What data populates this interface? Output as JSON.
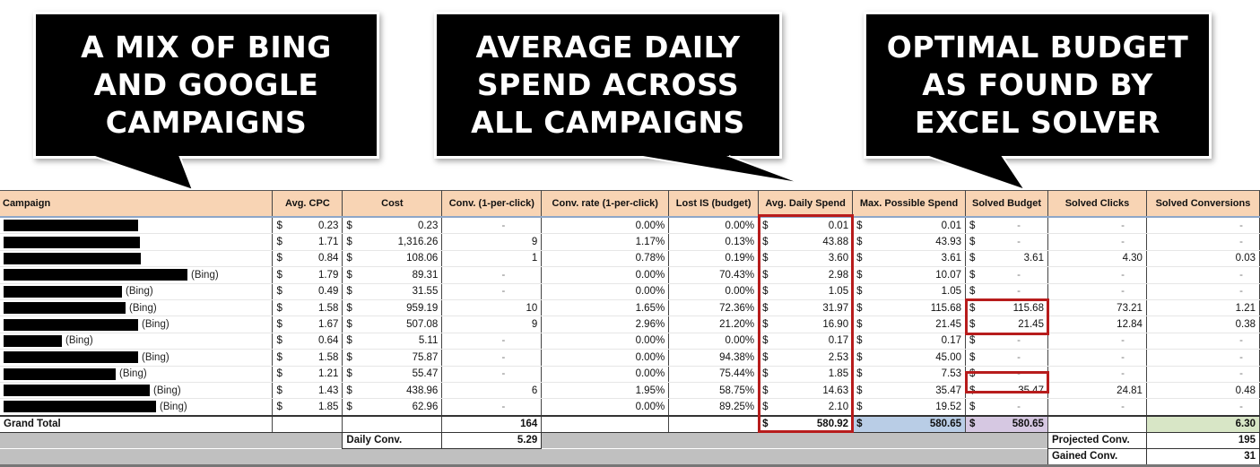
{
  "callouts": [
    {
      "lines": [
        "A MIX OF BING",
        "AND GOOGLE",
        "CAMPAIGNS"
      ]
    },
    {
      "lines": [
        "AVERAGE DAILY",
        "SPEND ACROSS",
        "ALL CAMPAIGNS"
      ]
    },
    {
      "lines": [
        "OPTIMAL BUDGET",
        "AS FOUND BY",
        "EXCEL SOLVER"
      ]
    }
  ],
  "colors": {
    "header_bg": "#f8d4b4",
    "highlight_red": "#b71c1c",
    "max_total_bg": "#b9cde6",
    "solved_total_bg": "#d6c8e2",
    "solved_conv_total_bg": "#d8e6c6",
    "footer_bg": "#c0c0c0"
  },
  "table": {
    "headers": {
      "campaign": "Campaign",
      "avg_cpc": "Avg. CPC",
      "cost": "Cost",
      "conv": "Conv. (1-per-click)",
      "conv_rate": "Conv. rate (1-per-click)",
      "lost_is": "Lost IS (budget)",
      "avg_daily_spend": "Avg. Daily Spend",
      "max_possible_spend": "Max. Possible Spend",
      "solved_budget": "Solved Budget",
      "solved_clicks": "Solved Clicks",
      "solved_conversions": "Solved Conversions"
    },
    "currency_symbol": "$",
    "rows": [
      {
        "tag": "",
        "redacted": true,
        "avg_cpc": "0.23",
        "cost": "0.23",
        "conv": "-",
        "conv_rate": "0.00%",
        "lost_is": "0.00%",
        "avg_daily_spend": "0.01",
        "max_possible_spend": "0.01",
        "solved_budget": "-",
        "solved_clicks": "-",
        "solved_conversions": "-"
      },
      {
        "tag": "",
        "redacted": true,
        "avg_cpc": "1.71",
        "cost": "1,316.26",
        "conv": "9",
        "conv_rate": "1.17%",
        "lost_is": "0.13%",
        "avg_daily_spend": "43.88",
        "max_possible_spend": "43.93",
        "solved_budget": "-",
        "solved_clicks": "-",
        "solved_conversions": "-"
      },
      {
        "tag": "",
        "redacted": true,
        "avg_cpc": "0.84",
        "cost": "108.06",
        "conv": "1",
        "conv_rate": "0.78%",
        "lost_is": "0.19%",
        "avg_daily_spend": "3.60",
        "max_possible_spend": "3.61",
        "solved_budget": "3.61",
        "solved_clicks": "4.30",
        "solved_conversions": "0.03"
      },
      {
        "tag": "(Bing)",
        "redacted": true,
        "avg_cpc": "1.79",
        "cost": "89.31",
        "conv": "-",
        "conv_rate": "0.00%",
        "lost_is": "70.43%",
        "avg_daily_spend": "2.98",
        "max_possible_spend": "10.07",
        "solved_budget": "-",
        "solved_clicks": "-",
        "solved_conversions": "-"
      },
      {
        "tag": "(Bing)",
        "redacted": true,
        "avg_cpc": "0.49",
        "cost": "31.55",
        "conv": "-",
        "conv_rate": "0.00%",
        "lost_is": "0.00%",
        "avg_daily_spend": "1.05",
        "max_possible_spend": "1.05",
        "solved_budget": "-",
        "solved_clicks": "-",
        "solved_conversions": "-"
      },
      {
        "tag": "(Bing)",
        "redacted": true,
        "avg_cpc": "1.58",
        "cost": "959.19",
        "conv": "10",
        "conv_rate": "1.65%",
        "lost_is": "72.36%",
        "avg_daily_spend": "31.97",
        "max_possible_spend": "115.68",
        "solved_budget": "115.68",
        "solved_clicks": "73.21",
        "solved_conversions": "1.21"
      },
      {
        "tag": "(Bing)",
        "redacted": true,
        "avg_cpc": "1.67",
        "cost": "507.08",
        "conv": "9",
        "conv_rate": "2.96%",
        "lost_is": "21.20%",
        "avg_daily_spend": "16.90",
        "max_possible_spend": "21.45",
        "solved_budget": "21.45",
        "solved_clicks": "12.84",
        "solved_conversions": "0.38"
      },
      {
        "tag": "(Bing)",
        "redacted": true,
        "avg_cpc": "0.64",
        "cost": "5.11",
        "conv": "-",
        "conv_rate": "0.00%",
        "lost_is": "0.00%",
        "avg_daily_spend": "0.17",
        "max_possible_spend": "0.17",
        "solved_budget": "-",
        "solved_clicks": "-",
        "solved_conversions": "-"
      },
      {
        "tag": "(Bing)",
        "redacted": true,
        "avg_cpc": "1.58",
        "cost": "75.87",
        "conv": "-",
        "conv_rate": "0.00%",
        "lost_is": "94.38%",
        "avg_daily_spend": "2.53",
        "max_possible_spend": "45.00",
        "solved_budget": "-",
        "solved_clicks": "-",
        "solved_conversions": "-"
      },
      {
        "tag": "(Bing)",
        "redacted": true,
        "avg_cpc": "1.21",
        "cost": "55.47",
        "conv": "-",
        "conv_rate": "0.00%",
        "lost_is": "75.44%",
        "avg_daily_spend": "1.85",
        "max_possible_spend": "7.53",
        "solved_budget": "-",
        "solved_clicks": "-",
        "solved_conversions": "-"
      },
      {
        "tag": "(Bing)",
        "redacted": true,
        "avg_cpc": "1.43",
        "cost": "438.96",
        "conv": "6",
        "conv_rate": "1.95%",
        "lost_is": "58.75%",
        "avg_daily_spend": "14.63",
        "max_possible_spend": "35.47",
        "solved_budget": "35.47",
        "solved_clicks": "24.81",
        "solved_conversions": "0.48"
      },
      {
        "tag": "(Bing)",
        "redacted": true,
        "avg_cpc": "1.85",
        "cost": "62.96",
        "conv": "-",
        "conv_rate": "0.00%",
        "lost_is": "89.25%",
        "avg_daily_spend": "2.10",
        "max_possible_spend": "19.52",
        "solved_budget": "-",
        "solved_clicks": "-",
        "solved_conversions": "-"
      }
    ],
    "grand_total": {
      "label": "Grand Total",
      "conv": "164",
      "avg_daily_spend": "580.92",
      "max_possible_spend": "580.65",
      "solved_budget": "580.65",
      "solved_conversions": "6.30"
    },
    "summary": {
      "daily_conv_label": "Daily Conv.",
      "daily_conv_value": "5.29",
      "projected_conv_label": "Projected Conv.",
      "projected_conv_value": "195",
      "gained_conv_label": "Gained Conv.",
      "gained_conv_value": "31"
    }
  }
}
